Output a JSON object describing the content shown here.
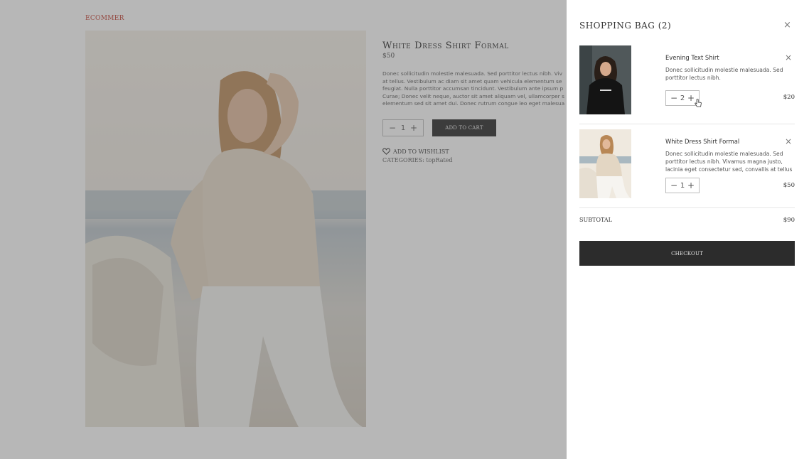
{
  "brand": "ECOMMER",
  "product": {
    "title": "White Dress Shirt Formal",
    "price": "$50",
    "description_lines": [
      "Donec sollicitudin molestie malesuada. Sed porttitor lectus nibh. Viv",
      "at tellus. Vestibulum ac diam sit amet quam vehicula elementum se",
      "feugiat. Nulla porttitor accumsan tincidunt. Vestibulum ante ipsum p",
      "Curae; Donec velit neque, auctor sit amet aliquam vel, ullamcorper s",
      "elementum sed sit amet dui. Donec rutrum congue leo eget malesua"
    ],
    "quantity": "1",
    "add_to_cart_label": "ADD TO CART",
    "wishlist_label": "ADD TO WISHLIST",
    "categories_label": "CATEGORIES: topRated"
  },
  "bag": {
    "title": "SHOPPING BAG (2)",
    "items": [
      {
        "name": "Evening Text Shirt",
        "description": "Donec sollicitudin molestie malesuada. Sed porttitor lectus nibh.",
        "quantity": "2",
        "price": "$20"
      },
      {
        "name": "White Dress Shirt Formal",
        "description": "Donec sollicitudin molestie malesuada. Sed porttitor lectus nibh. Vivamus magna justo, lacinia eget consectetur sed, convallis at tellus",
        "quantity": "1",
        "price": "$50"
      }
    ],
    "subtotal_label": "SUBTOTAL",
    "subtotal_value": "$90",
    "checkout_label": "CHECKOUT"
  },
  "icons": {
    "close": "close-icon",
    "minus": "minus-icon",
    "plus": "plus-icon",
    "heart": "heart-icon",
    "cursor": "hand-pointer-icon"
  },
  "symbols": {
    "close": "×",
    "minus": "−",
    "plus": "+"
  }
}
